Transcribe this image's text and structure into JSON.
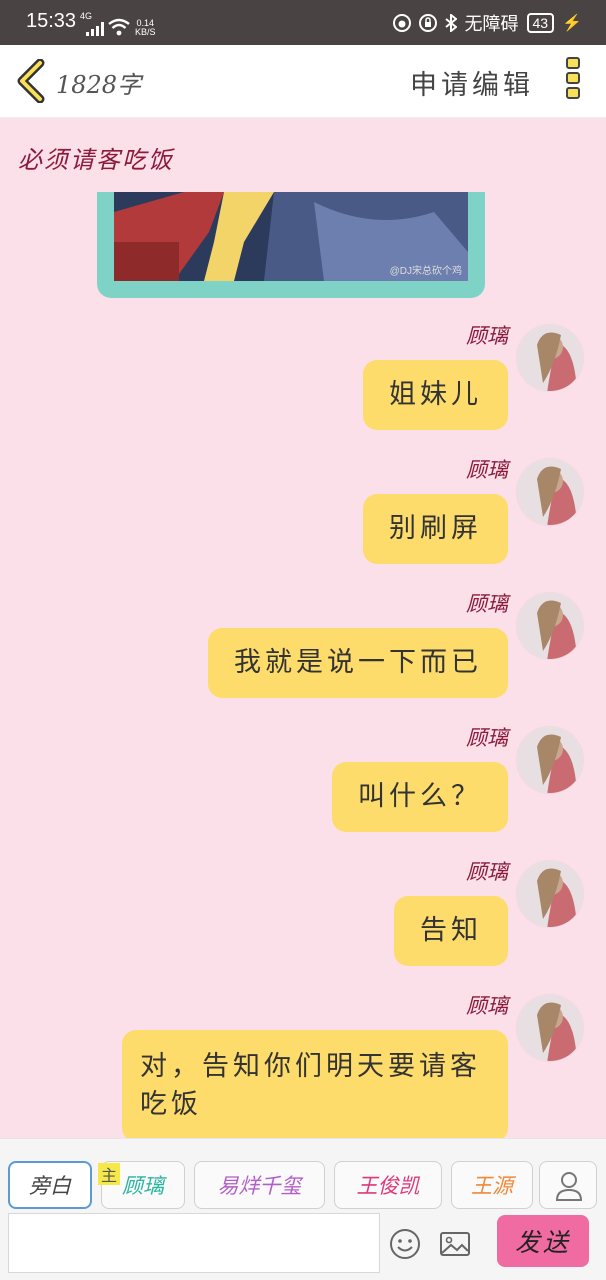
{
  "status_bar": {
    "time": "15:33",
    "network": "4G",
    "speed_value": "0.14",
    "speed_unit": "KB/S",
    "accessibility": "无障碍",
    "battery": "43"
  },
  "header": {
    "word_count": "1828字",
    "apply_edit": "申请编辑",
    "back_icon": "chevron-left-icon",
    "more_icon": "more-vertical-icon"
  },
  "chat": {
    "title": "必须请客吃饭",
    "image_watermark": "@DJ宋总砍个鸡",
    "messages": [
      {
        "sender": "顾璃",
        "text": "姐妹儿"
      },
      {
        "sender": "顾璃",
        "text": "别刷屏"
      },
      {
        "sender": "顾璃",
        "text": "我就是说一下而已"
      },
      {
        "sender": "顾璃",
        "text": "叫什么？"
      },
      {
        "sender": "顾璃",
        "text": "告知"
      },
      {
        "sender": "顾璃",
        "text": "对，告知你们明天要请客吃饭"
      }
    ]
  },
  "bottom_bar": {
    "roles": [
      {
        "label": "旁白",
        "color": "#444444"
      },
      {
        "label": "顾璃",
        "color": "#2bb5a0",
        "tag": "主"
      },
      {
        "label": "易烊千玺",
        "color": "#b35ec8"
      },
      {
        "label": "王俊凯",
        "color": "#e0387a"
      },
      {
        "label": "王源",
        "color": "#f08a3a"
      }
    ],
    "input_placeholder": "",
    "send_label": "发送",
    "emoji_icon": "smiley-icon",
    "image_icon": "image-icon",
    "person_icon": "person-icon"
  },
  "colors": {
    "background": "#fbe0ea",
    "bubble": "#fddc6c",
    "send_button": "#f06ba1",
    "name": "#8b1a3c",
    "frame": "#7fd3c6"
  }
}
